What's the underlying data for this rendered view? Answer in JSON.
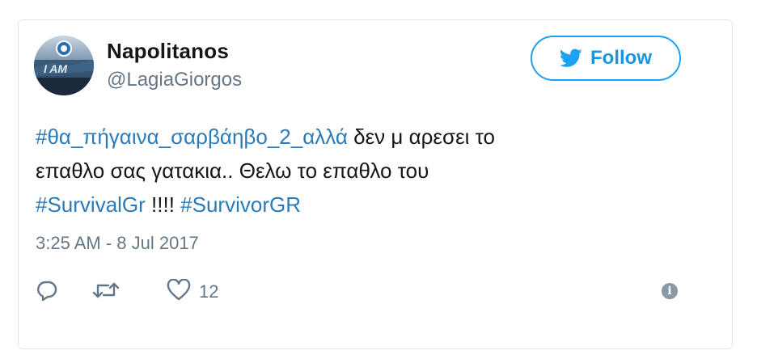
{
  "tweet": {
    "author": {
      "name": "Napolitanos",
      "handle": "@LagiaGiorgos"
    },
    "follow_label": "Follow",
    "text": {
      "hashtag_1": "#θα_πήγαινα_σαρβάηβο_2_αλλά",
      "line_1_rest": " δεν μ αρεσει το",
      "line_2": "επαθλο σας γατακια.. Θελω το επαθλο του",
      "hashtag_2": "#SurvivalGr",
      "between_tags": " !!!! ",
      "hashtag_3": "#SurvivorGR"
    },
    "timestamp": "3:25 AM - 8 Jul 2017",
    "actions": {
      "like_count": "12"
    },
    "info_icon_glyph": "i"
  },
  "colors": {
    "twitter_blue": "#1da1f2",
    "link_blue": "#2b7bb9",
    "muted_gray": "#657786",
    "text_dark": "#14171a",
    "border": "#e1e8ed"
  },
  "icons": [
    "twitter-bird-icon",
    "reply-icon",
    "retweet-icon",
    "heart-icon",
    "info-icon"
  ]
}
